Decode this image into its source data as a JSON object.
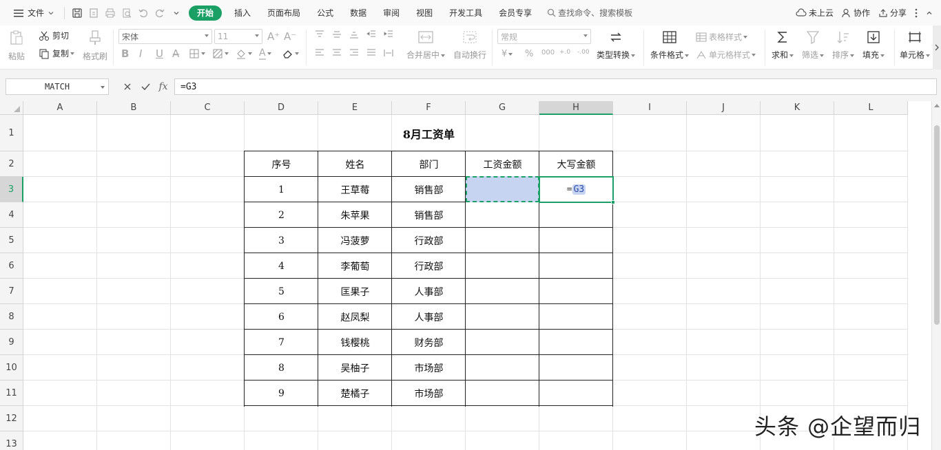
{
  "menu": {
    "file_label": "文件",
    "tabs": [
      {
        "label": "开始",
        "active": true
      },
      {
        "label": "插入"
      },
      {
        "label": "页面布局"
      },
      {
        "label": "公式"
      },
      {
        "label": "数据"
      },
      {
        "label": "审阅"
      },
      {
        "label": "视图"
      },
      {
        "label": "开发工具"
      },
      {
        "label": "会员专享"
      }
    ],
    "search_label": "查找命令、搜索模板",
    "cloud_label": "未上云",
    "collab_label": "协作",
    "share_label": "分享"
  },
  "toolbar": {
    "paste": "粘贴",
    "cut": "剪切",
    "copy": "复制",
    "format_painter": "格式刷",
    "font_name": "宋体",
    "font_size": "11",
    "merge_center": "合并居中",
    "wrap_text": "自动换行",
    "number_format": "常规",
    "type_convert": "类型转换",
    "cond_format": "条件格式",
    "table_style": "表格样式",
    "cell_style": "单元格样式",
    "sum": "求和",
    "filter": "筛选",
    "sort": "排序",
    "fill": "填充",
    "cell": "单元格"
  },
  "formula_bar": {
    "name_box": "MATCH",
    "formula": "=G3",
    "fx": "fx"
  },
  "sheet": {
    "columns": [
      "A",
      "B",
      "C",
      "D",
      "E",
      "F",
      "G",
      "H",
      "I",
      "J",
      "K",
      "L"
    ],
    "rows": [
      "1",
      "2",
      "3",
      "4",
      "5",
      "6",
      "7",
      "8",
      "9",
      "10",
      "11",
      "12",
      "13"
    ],
    "title": "8月工资单",
    "headers": [
      "序号",
      "姓名",
      "部门",
      "工资金额",
      "大写金额"
    ],
    "records": [
      {
        "no": "1",
        "name": "王草莓",
        "dept": "销售部"
      },
      {
        "no": "2",
        "name": "朱苹果",
        "dept": "销售部"
      },
      {
        "no": "3",
        "name": "冯菠萝",
        "dept": "行政部"
      },
      {
        "no": "4",
        "name": "李葡萄",
        "dept": "行政部"
      },
      {
        "no": "5",
        "name": "匡果子",
        "dept": "人事部"
      },
      {
        "no": "6",
        "name": "赵凤梨",
        "dept": "人事部"
      },
      {
        "no": "7",
        "name": "钱樱桃",
        "dept": "财务部"
      },
      {
        "no": "8",
        "name": "吴柚子",
        "dept": "市场部"
      },
      {
        "no": "9",
        "name": "楚橘子",
        "dept": "市场部"
      }
    ],
    "editing_cell": {
      "prefix": "=",
      "ref": "G3"
    },
    "selected_column": "H",
    "selected_row": "3"
  },
  "watermark": "头条 @企望而归",
  "colors": {
    "accent": "#1aa064",
    "ref_highlight": "#c6d4f2"
  }
}
